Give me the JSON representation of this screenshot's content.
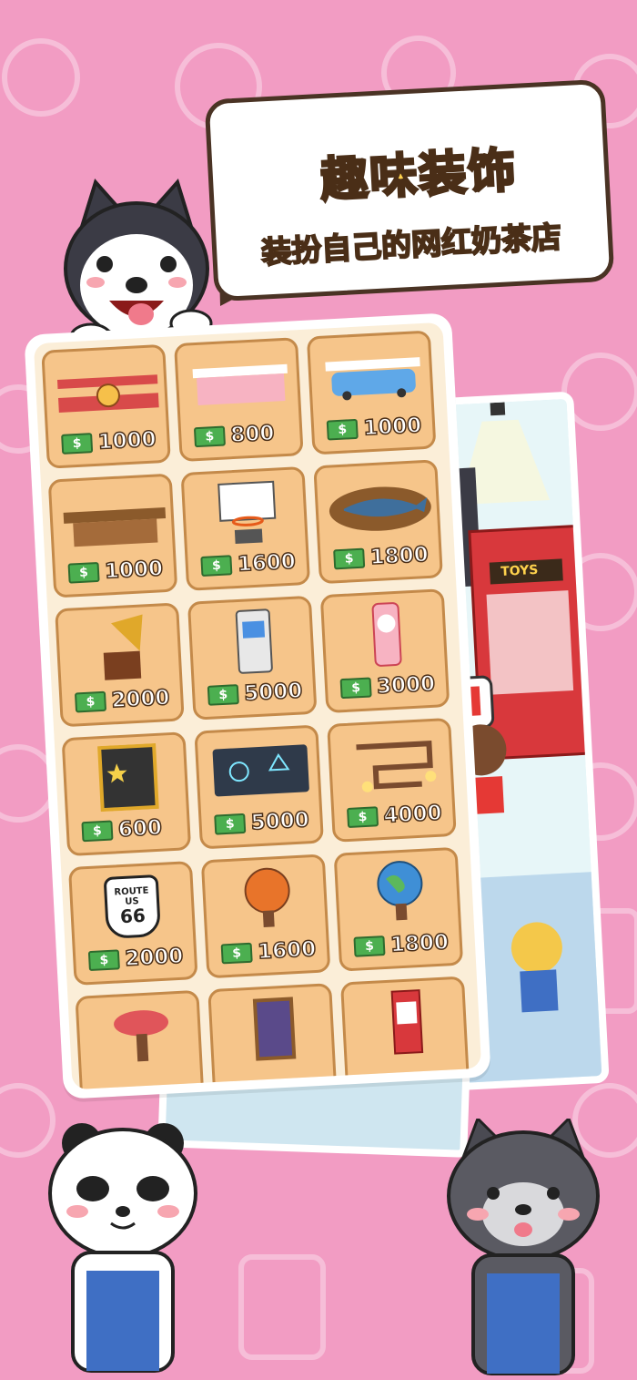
{
  "header": {
    "title": "趣味装饰",
    "subtitle": "装扮自己的网红奶茶店"
  },
  "shop": {
    "items": [
      {
        "name": "airplane-counter",
        "price": "1000"
      },
      {
        "name": "pink-counter",
        "price": "800"
      },
      {
        "name": "car-counter",
        "price": "1000"
      },
      {
        "name": "wooden-counter",
        "price": "1000"
      },
      {
        "name": "basketball-hoop",
        "price": "1600"
      },
      {
        "name": "marlin-plaque",
        "price": "1800"
      },
      {
        "name": "gramophone",
        "price": "2000"
      },
      {
        "name": "arcade-machine",
        "price": "5000"
      },
      {
        "name": "gumball-machine",
        "price": "3000"
      },
      {
        "name": "star-board",
        "price": "600"
      },
      {
        "name": "neon-sign",
        "price": "5000"
      },
      {
        "name": "pipe-lamp",
        "price": "4000"
      },
      {
        "name": "route-66-sign",
        "price": "2000"
      },
      {
        "name": "basketball-table",
        "price": "1600"
      },
      {
        "name": "globe-table",
        "price": "1800"
      },
      {
        "name": "red-stool",
        "price": ""
      },
      {
        "name": "menu-board",
        "price": ""
      },
      {
        "name": "mini-claw-machine",
        "price": ""
      }
    ]
  },
  "scene": {
    "claw_machine_label": "TOYS",
    "route_sign": {
      "top": "ROUTE",
      "mid": "US",
      "num": "66"
    }
  },
  "colors": {
    "background": "#f29cc3",
    "title_fill": "#ffd24d",
    "outline": "#4a2e17",
    "card": "#f6c58a",
    "money": "#4caf50"
  }
}
